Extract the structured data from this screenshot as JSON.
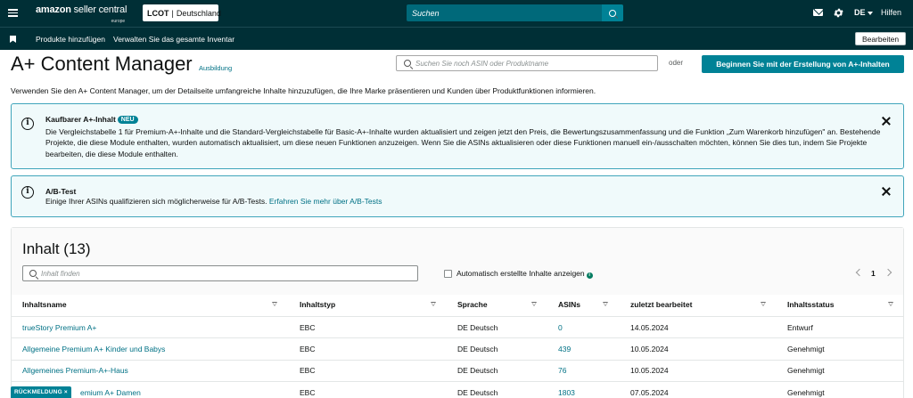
{
  "topbar": {
    "logo_main": "amazon",
    "logo_rest": "seller central",
    "logo_sub": "europe",
    "store_code": "LCOT",
    "store_separator": "|",
    "store_country": "Deutschland",
    "search_placeholder": "Suchen",
    "language": "DE",
    "help": "Hilfen"
  },
  "navbar": {
    "links": [
      "Produkte hinzufügen",
      "Verwalten Sie das gesamte Inventar"
    ],
    "edit_label": "Bearbeiten"
  },
  "header": {
    "title": "A+ Content Manager",
    "training_link": "Ausbildung",
    "asin_search_placeholder": "Suchen Sie noch ASIN oder Produktname",
    "or_text": "oder",
    "cta_label": "Beginnen Sie mit der Erstellung von A+-Inhalten",
    "intro": "Verwenden Sie den A+ Content Manager, um der Detailseite umfangreiche Inhalte hinzuzufügen, die Ihre Marke präsentieren und Kunden über Produktfunktionen informieren."
  },
  "alerts": [
    {
      "title": "Kaufbarer A+-Inhalt",
      "badge": "NEU",
      "body": "Die Vergleichstabelle 1 für Premium-A+-Inhalte und die Standard-Vergleichstabelle für Basic-A+-Inhalte wurden aktualisiert und zeigen jetzt den Preis, die Bewertungszusammenfassung und die Funktion „Zum Warenkorb hinzufügen\" an. Bestehende Projekte, die diese Module enthalten, wurden automatisch aktualisiert, um diese neuen Funktionen anzuzeigen. Wenn Sie die ASINs aktualisieren oder diese Funktionen manuell ein-/ausschalten möchten, können Sie dies tun, indem Sie Projekte bearbeiten, die diese Module enthalten."
    },
    {
      "title": "A/B-Test",
      "body": "Einige Ihrer ASINs qualifizieren sich möglicherweise für A/B-Tests.",
      "link": "Erfahren Sie mehr über A/B-Tests"
    }
  ],
  "content": {
    "title": "Inhalt (13)",
    "filter_placeholder": "Inhalt finden",
    "auto_checkbox_label": "Automatisch erstellte Inhalte anzeigen",
    "info_glyph": "i",
    "page": "1",
    "columns": [
      "Inhaltsname",
      "Inhaltstyp",
      "Sprache",
      "ASINs",
      "zuletzt bearbeitet",
      "Inhaltsstatus"
    ],
    "rows": [
      {
        "name": "trueStory Premium A+",
        "type": "EBC",
        "language": "DE Deutsch",
        "asins": "0",
        "edited": "14.05.2024",
        "status": "Entwurf"
      },
      {
        "name": "Allgemeine Premium A+ Kinder und Babys",
        "type": "EBC",
        "language": "DE Deutsch",
        "asins": "439",
        "edited": "10.05.2024",
        "status": "Genehmigt"
      },
      {
        "name": "Allgemeines Premium-A+-Haus",
        "type": "EBC",
        "language": "DE Deutsch",
        "asins": "76",
        "edited": "10.05.2024",
        "status": "Genehmigt"
      },
      {
        "name": "emium A+ Damen",
        "type": "EBC",
        "language": "DE Deutsch",
        "asins": "1803",
        "edited": "07.05.2024",
        "status": "Genehmigt"
      }
    ]
  },
  "feedback": {
    "label": "RÜCKMELDUNG",
    "close_glyph": "×"
  },
  "icons": {
    "info": "i"
  },
  "colors": {
    "topbar": "#002f36",
    "accent": "#008296",
    "link": "#007185",
    "alert_bg": "#f0fafb",
    "alert_border": "#40a5bb"
  }
}
